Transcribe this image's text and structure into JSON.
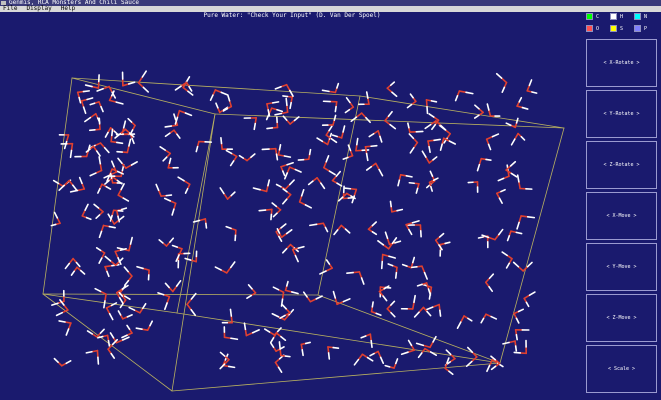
{
  "window": {
    "title": "Genmis, RCA Monsters And Chili Sauce"
  },
  "menu": [
    {
      "label": "File"
    },
    {
      "label": "Display"
    },
    {
      "label": "Help"
    }
  ],
  "viewport": {
    "caption": "Pure Water: \"Check Your Input\" (D. Van Der Spoel)",
    "background": "#1a1a6e",
    "box_color": "#b8b060",
    "atom_colors": {
      "O": "#e04030",
      "H": "#ffffff"
    }
  },
  "legend": [
    {
      "symbol": "C",
      "color": "#00ff00"
    },
    {
      "symbol": "H",
      "color": "#ffffff"
    },
    {
      "symbol": "N",
      "color": "#00ffff"
    },
    {
      "symbol": "O",
      "color": "#ff5050"
    },
    {
      "symbol": "S",
      "color": "#ffff00"
    },
    {
      "symbol": "P",
      "color": "#8080ff"
    }
  ],
  "buttons": [
    {
      "label": "< X-Rotate >"
    },
    {
      "label": "< Y-Rotate >"
    },
    {
      "label": "< Z-Rotate >"
    },
    {
      "label": "< X-Move >"
    },
    {
      "label": "< Y-Move >"
    },
    {
      "label": "< Z-Move >"
    },
    {
      "label": "< Scale >"
    }
  ]
}
